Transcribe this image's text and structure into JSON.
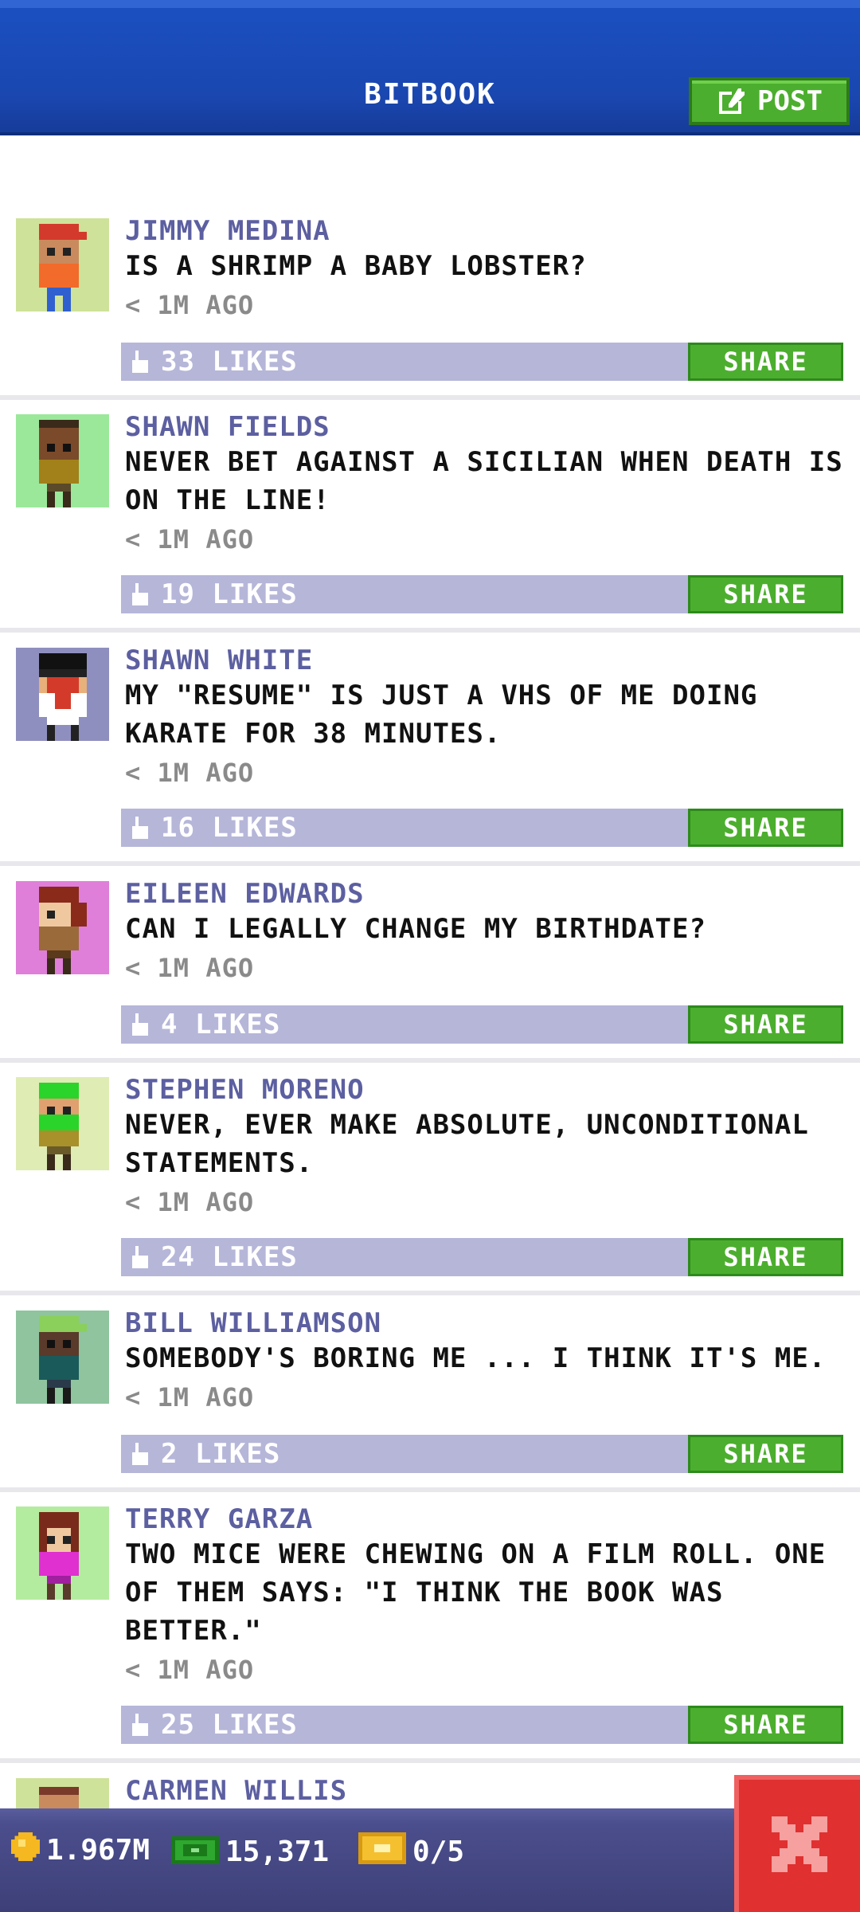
{
  "header": {
    "title": "BITBOOK",
    "post_label": "POST"
  },
  "posts": [
    {
      "name": "JIMMY MEDINA",
      "text": "IS A SHRIMP A BABY LOBSTER?",
      "time": "< 1M AGO",
      "likes": "33 LIKES",
      "share": "SHARE",
      "avatar_bg": "#cfe29a"
    },
    {
      "name": "SHAWN FIELDS",
      "text": "NEVER BET AGAINST A SICILIAN WHEN DEATH IS ON THE LINE!",
      "time": "< 1M AGO",
      "likes": "19 LIKES",
      "share": "SHARE",
      "avatar_bg": "#9be89b"
    },
    {
      "name": "SHAWN WHITE",
      "text": "MY \"RESUME\" IS JUST A VHS OF ME DOING KARATE FOR 38 MINUTES.",
      "time": "< 1M AGO",
      "likes": "16 LIKES",
      "share": "SHARE",
      "avatar_bg": "#8f8fbf"
    },
    {
      "name": "EILEEN EDWARDS",
      "text": "CAN I LEGALLY CHANGE MY BIRTHDATE?",
      "time": "< 1M AGO",
      "likes": "4 LIKES",
      "share": "SHARE",
      "avatar_bg": "#df7fd9"
    },
    {
      "name": "STEPHEN MORENO",
      "text": "NEVER, EVER MAKE ABSOLUTE, UNCONDITIONAL STATEMENTS.",
      "time": "< 1M AGO",
      "likes": "24 LIKES",
      "share": "SHARE",
      "avatar_bg": "#dfecb4"
    },
    {
      "name": "BILL WILLIAMSON",
      "text": "SOMEBODY'S BORING ME ... I THINK IT'S ME.",
      "time": "< 1M AGO",
      "likes": "2 LIKES",
      "share": "SHARE",
      "avatar_bg": "#8fc49f"
    },
    {
      "name": "TERRY GARZA",
      "text": "TWO MICE WERE CHEWING ON A FILM ROLL. ONE OF THEM SAYS: \"I THINK THE BOOK WAS BETTER.\"",
      "time": "< 1M AGO",
      "likes": "25 LIKES",
      "share": "SHARE",
      "avatar_bg": "#b4ec9f"
    },
    {
      "name": "CARMEN WILLIS",
      "avatar_bg": "#cfe29a"
    }
  ],
  "footer": {
    "coins": "1.967M",
    "bux": "15,371",
    "tickets": "0/5"
  },
  "colors": {
    "header_blue": "#1a47b0",
    "share_green": "#4cae2e",
    "likes_bar": "#b5b6d8",
    "close_red": "#e03030"
  }
}
